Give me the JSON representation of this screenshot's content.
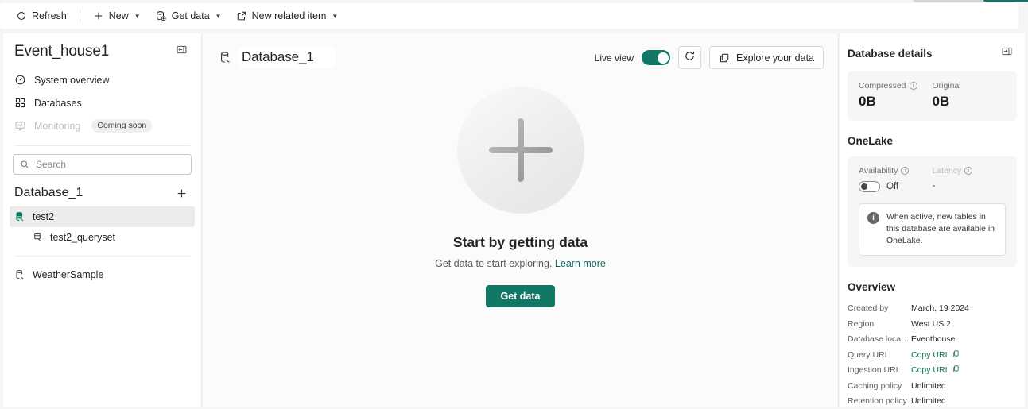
{
  "commandbar": {
    "items": [
      {
        "label": "Refresh",
        "icon": "refresh-icon",
        "caret": false
      },
      {
        "label": "New",
        "icon": "plus-icon",
        "caret": true
      },
      {
        "label": "Get data",
        "icon": "get-data-icon",
        "caret": true
      },
      {
        "label": "New related item",
        "icon": "external-link-icon",
        "caret": true
      }
    ]
  },
  "sidebar": {
    "title": "Event_house1",
    "collapse_icon": "collapse-panel-icon",
    "nav": [
      {
        "label": "System overview",
        "icon": "gauge-icon",
        "disabled": false,
        "badge": ""
      },
      {
        "label": "Databases",
        "icon": "grid-icon",
        "disabled": false,
        "badge": ""
      },
      {
        "label": "Monitoring",
        "icon": "monitor-icon",
        "disabled": true,
        "badge": "Coming soon"
      }
    ],
    "search": {
      "placeholder": "Search",
      "value": "",
      "icon": "search-icon"
    },
    "tree_title": "Database_1",
    "add_icon": "plus-icon",
    "tree": [
      {
        "label": "test2",
        "icon": "database-green-icon",
        "selected": true,
        "child": false
      },
      {
        "label": "test2_queryset",
        "icon": "queryset-icon",
        "selected": false,
        "child": true
      },
      {
        "label": "WeatherSample",
        "icon": "database-icon",
        "selected": false,
        "child": false
      }
    ]
  },
  "main": {
    "title": "Database_1",
    "title_icon": "database-icon",
    "live_view_label": "Live view",
    "live_view_on": true,
    "refresh_icon": "refresh-icon",
    "explore_label": "Explore your data",
    "explore_icon": "explore-icon",
    "empty": {
      "plus_icon": "large-plus-icon",
      "title": "Start by getting data",
      "subtitle": "Get data to start exploring.",
      "link": "Learn more",
      "button": "Get data"
    }
  },
  "right": {
    "title": "Database details",
    "expand_icon": "expand-panel-icon",
    "stats": [
      {
        "label": "Compressed",
        "info": true,
        "value": "0B"
      },
      {
        "label": "Original",
        "info": false,
        "value": "0B"
      }
    ],
    "onelake": {
      "title": "OneLake",
      "availability_label": "Availability",
      "availability_value": "Off",
      "availability_on": false,
      "latency_label": "Latency",
      "latency_value": "-",
      "note": "When active, new tables in this database are available in OneLake.",
      "note_icon": "info-icon"
    },
    "overview": {
      "title": "Overview",
      "rows": [
        {
          "key": "Created by",
          "value": "March, 19 2024",
          "link": false
        },
        {
          "key": "Region",
          "value": "West US 2",
          "link": false
        },
        {
          "key": "Database locati...",
          "value": "Eventhouse",
          "link": false
        },
        {
          "key": "Query URI",
          "value": "Copy URI",
          "link": true
        },
        {
          "key": "Ingestion URL",
          "value": "Copy URI",
          "link": true
        },
        {
          "key": "Caching policy",
          "value": "Unlimited",
          "link": false
        },
        {
          "key": "Retention policy",
          "value": "Unlimited",
          "link": false
        }
      ]
    }
  },
  "colors": {
    "accent": "#117865",
    "link": "#11705f",
    "selected_row": "#ebebeb"
  }
}
